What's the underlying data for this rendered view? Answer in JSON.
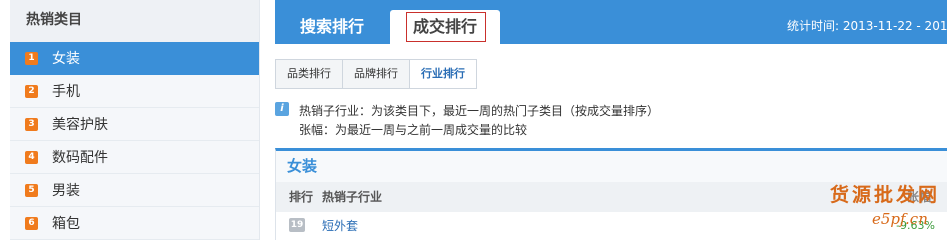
{
  "sidebar": {
    "title": "热销类目",
    "items": [
      {
        "num": "1",
        "label": "女装"
      },
      {
        "num": "2",
        "label": "手机"
      },
      {
        "num": "3",
        "label": "美容护肤"
      },
      {
        "num": "4",
        "label": "数码配件"
      },
      {
        "num": "5",
        "label": "男装"
      },
      {
        "num": "6",
        "label": "箱包"
      }
    ]
  },
  "tabs": {
    "search": "搜索排行",
    "deal": "成交排行"
  },
  "stat_time": "统计时间: 2013-11-22 - 2013",
  "subtabs": [
    "品类排行",
    "品牌排行",
    "行业排行"
  ],
  "info": {
    "icon": "i",
    "line1": "热销子行业：为该类目下，最近一周的热门子类目（按成交量排序）",
    "line2": "张幅：为最近一周与之前一周成交量的比较"
  },
  "panel": {
    "title": "女装",
    "col_rank": "排行",
    "col_industry": "热销子行业",
    "col_change": "张幅",
    "rows": [
      {
        "rank": "19",
        "industry": "短外套",
        "change": "-9.63%"
      }
    ]
  },
  "watermark": {
    "text": "货源批发网",
    "site": "e5pf.cn"
  }
}
